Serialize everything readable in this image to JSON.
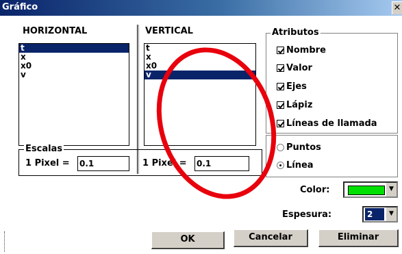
{
  "window": {
    "title": "Gráfico",
    "close_glyph": "✕"
  },
  "horizontal": {
    "header": "HORIZONTAL",
    "items": [
      "t",
      "x",
      "x0",
      "v"
    ],
    "selected": "t"
  },
  "vertical": {
    "header": "VERTICAL",
    "items": [
      "t",
      "x",
      "x0",
      "v"
    ],
    "selected": "v"
  },
  "escalas": {
    "title": "Escalas",
    "h_label": "1 Pixel =",
    "h_value": "0.1",
    "v_label": "1 Pixel =",
    "v_value": "0.1"
  },
  "atributos": {
    "title": "Atributos",
    "items": [
      {
        "label": "Nombre",
        "checked": true
      },
      {
        "label": "Valor",
        "checked": true
      },
      {
        "label": "Ejes",
        "checked": true
      },
      {
        "label": "Lápiz",
        "checked": true
      },
      {
        "label": "Líneas de llamada",
        "checked": true
      }
    ]
  },
  "modo": {
    "options": [
      {
        "label": "Puntos",
        "selected": false
      },
      {
        "label": "Línea",
        "selected": true
      }
    ]
  },
  "color": {
    "label": "Color:",
    "value": "#00e000"
  },
  "espesura": {
    "label": "Espesura:",
    "value": "2"
  },
  "buttons": {
    "ok": "OK",
    "cancel": "Cancelar",
    "delete": "Eliminar"
  },
  "colors": {
    "title_bar": "#0a246a",
    "selection": "#0a246a",
    "annotation": "#e8000c"
  }
}
